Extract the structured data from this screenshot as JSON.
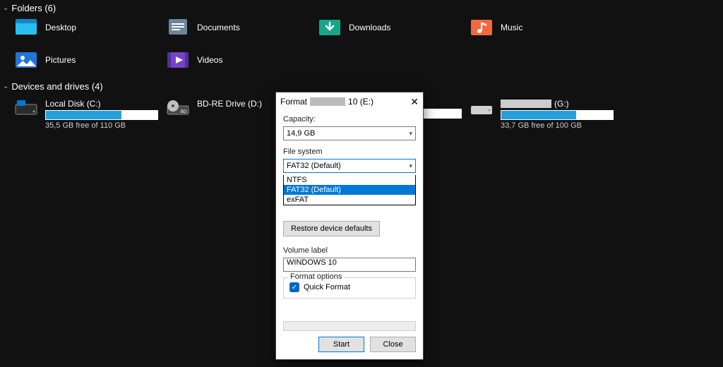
{
  "folders": {
    "header": "Folders (6)",
    "items": [
      {
        "label": "Desktop"
      },
      {
        "label": "Documents"
      },
      {
        "label": "Downloads"
      },
      {
        "label": "Music"
      },
      {
        "label": "Pictures"
      },
      {
        "label": "Videos"
      }
    ]
  },
  "drives": {
    "header": "Devices and drives (4)",
    "items": [
      {
        "label": "Local Disk (C:)",
        "free_text": "35,5 GB free of 110 GB",
        "fill_pct": 68,
        "anon": false
      },
      {
        "label": "BD-RE Drive (D:)",
        "free_text": "",
        "fill_pct": null,
        "anon": false
      },
      {
        "label": "",
        "free_text": "",
        "fill_pct": 45,
        "anon": true
      },
      {
        "label": "(G:)",
        "free_text": "33,7 GB free of 100 GB",
        "fill_pct": 67,
        "anon": true
      }
    ]
  },
  "dialog": {
    "title_prefix": "Format",
    "title_suffix": "10 (E:)",
    "capacity_label": "Capacity:",
    "capacity_value": "14,9 GB",
    "fs_label": "File system",
    "fs_value": "FAT32 (Default)",
    "fs_options": [
      "NTFS",
      "FAT32 (Default)",
      "exFAT"
    ],
    "fs_selected_index": 1,
    "restore_btn": "Restore device defaults",
    "vol_label": "Volume label",
    "vol_value": "WINDOWS 10",
    "options_header": "Format options",
    "quick_format": "Quick Format",
    "quick_format_checked": true,
    "start_btn": "Start",
    "close_btn": "Close"
  }
}
